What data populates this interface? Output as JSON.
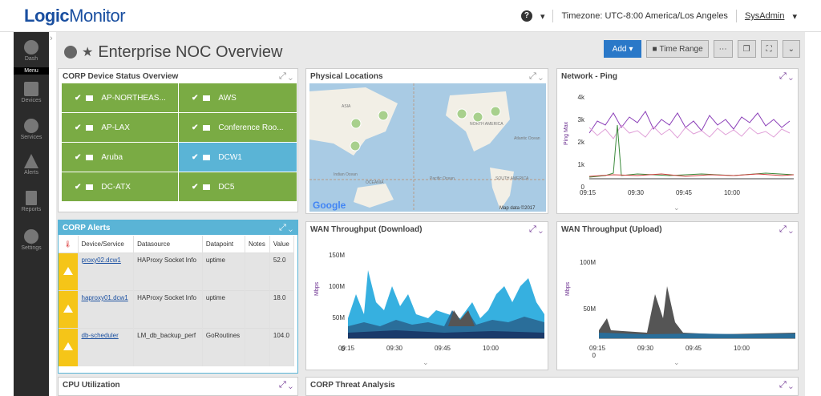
{
  "app": {
    "logo_prefix": "Logic",
    "logo_suffix": "Monitor"
  },
  "topbar": {
    "help": "?",
    "timezone": "Timezone: UTC-8:00 America/Los Angeles",
    "user": "SysAdmin"
  },
  "sidebar": {
    "menu_label": "Menu",
    "items": [
      {
        "label": "Dash"
      },
      {
        "label": "Devices"
      },
      {
        "label": "Services"
      },
      {
        "label": "Alerts"
      },
      {
        "label": "Reports"
      },
      {
        "label": "Settings"
      }
    ]
  },
  "dashboard": {
    "title": "Enterprise NOC Overview"
  },
  "toolbar": {
    "add_label": "Add",
    "time_range_label": "Time Range"
  },
  "device_status": {
    "title": "CORP Device Status Overview",
    "tiles": [
      {
        "label": "AP-NORTHEAS...",
        "color": "#7aab44"
      },
      {
        "label": "AWS",
        "color": "#7aab44"
      },
      {
        "label": "AP-LAX",
        "color": "#7aab44"
      },
      {
        "label": "Conference Roo...",
        "color": "#7aab44"
      },
      {
        "label": "Aruba",
        "color": "#7aab44"
      },
      {
        "label": "DCW1",
        "color": "#5ab4d6"
      },
      {
        "label": "DC-ATX",
        "color": "#7aab44"
      },
      {
        "label": "DC5",
        "color": "#7aab44"
      }
    ]
  },
  "map": {
    "title": "Physical Locations",
    "labels": {
      "asia": "ASIA",
      "north_america": "NORTH AMERICA",
      "south_america": "SOUTH AMERICA",
      "oceania": "OCEANIA",
      "indian_ocean": "Indian Ocean",
      "pacific_ocean": "Pacific Ocean",
      "atlantic_ocean": "Atlantic Ocean"
    },
    "google": "Google",
    "attribution": "Map data ©2017"
  },
  "ping": {
    "title": "Network - Ping",
    "ylabel": "Ping Max",
    "yticks": [
      "4k",
      "3k",
      "2k",
      "1k",
      "0"
    ],
    "xticks": [
      "09:15",
      "09:30",
      "09:45",
      "10:00"
    ]
  },
  "alerts": {
    "title": "CORP Alerts",
    "columns": [
      "Device/Service",
      "Datasource",
      "Datapoint",
      "Notes",
      "Value"
    ],
    "rows": [
      {
        "device": "proxy02.dcw1",
        "datasource": "HAProxy Socket Info",
        "datapoint": "uptime",
        "notes": "",
        "value": "52.0"
      },
      {
        "device": "haproxy01.dcw1",
        "datasource": "HAProxy Socket Info",
        "datapoint": "uptime",
        "notes": "",
        "value": "18.0"
      },
      {
        "device": "db-scheduler",
        "datasource": "LM_db_backup_perf",
        "datapoint": "GoRoutines",
        "notes": "",
        "value": "104.0"
      }
    ]
  },
  "wan_down": {
    "title": "WAN Throughput (Download)",
    "ylabel": "Mbps",
    "yticks": [
      "150M",
      "100M",
      "50M",
      "0"
    ],
    "xticks": [
      "09:15",
      "09:30",
      "09:45",
      "10:00"
    ]
  },
  "wan_up": {
    "title": "WAN Throughput (Upload)",
    "ylabel": "Mbps",
    "yticks": [
      "100M",
      "50M",
      "0"
    ],
    "xticks": [
      "09:15",
      "09:30",
      "09:45",
      "10:00"
    ]
  },
  "cpu": {
    "title": "CPU Utilization"
  },
  "threat": {
    "title": "CORP Threat Analysis"
  },
  "colors": {
    "accent": "#2a78c8",
    "ok": "#7aab44",
    "info": "#5ab4d6",
    "warning": "#f5c518",
    "purple": "#6a2d8f"
  }
}
